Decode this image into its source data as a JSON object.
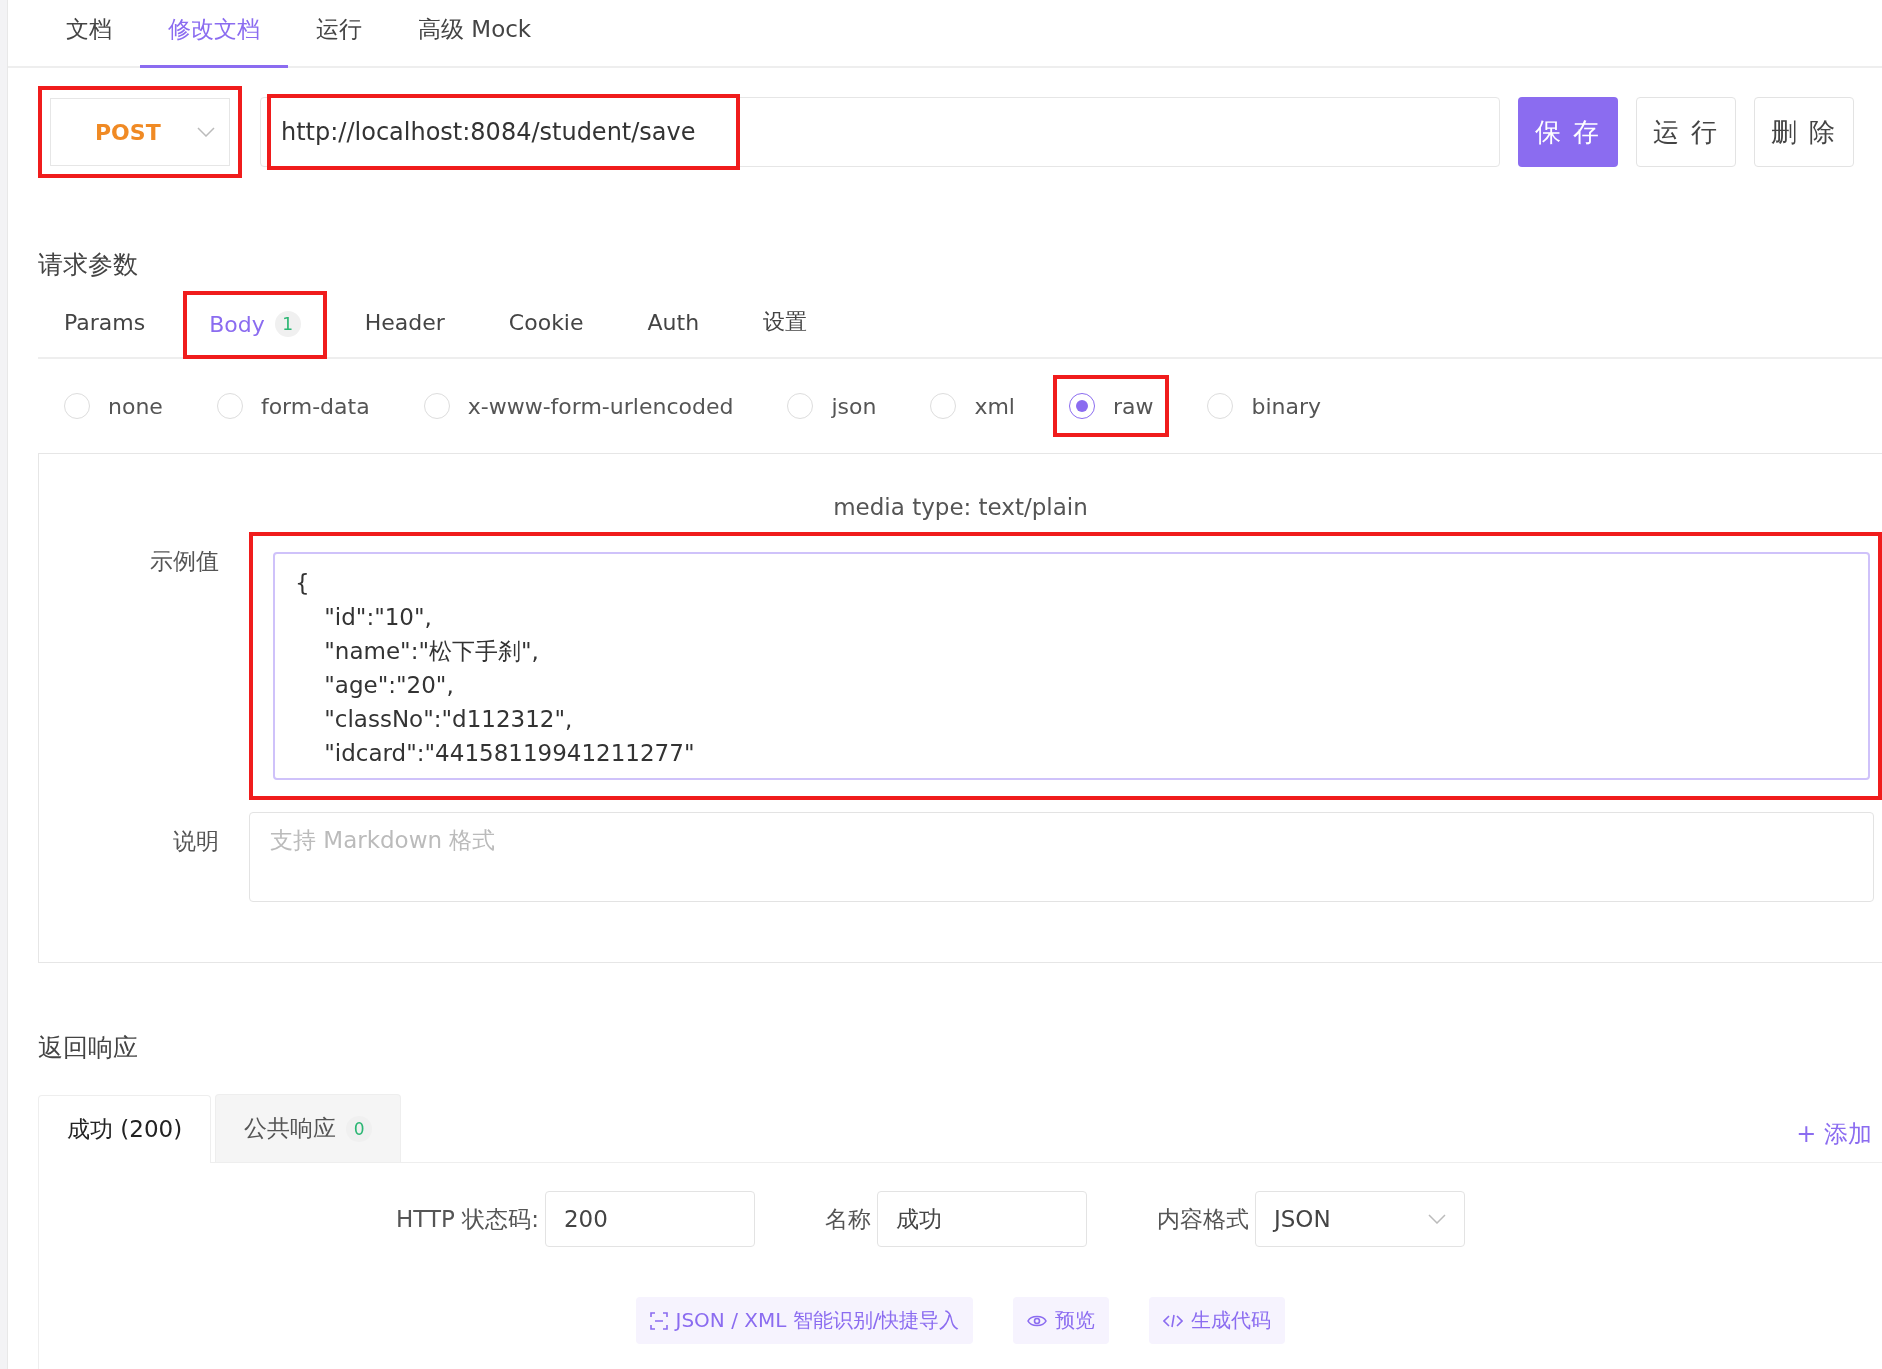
{
  "top_tabs": [
    {
      "label": "文档",
      "selected": false
    },
    {
      "label": "修改文档",
      "selected": true
    },
    {
      "label": "运行",
      "selected": false
    },
    {
      "label": "高级 Mock",
      "selected": false
    }
  ],
  "request": {
    "method": "POST",
    "method_highlighted": true,
    "url": "http://localhost:8084/student/save",
    "url_highlighted": true,
    "buttons": [
      {
        "label": "保 存",
        "kind": "primary"
      },
      {
        "label": "运 行",
        "kind": "default"
      },
      {
        "label": "删 除",
        "kind": "default"
      }
    ]
  },
  "params": {
    "title": "请求参数",
    "tabs": [
      {
        "label": "Params",
        "selected": false,
        "highlighted": false
      },
      {
        "label": "Body",
        "count": "1",
        "selected": true,
        "highlighted": true
      },
      {
        "label": "Header",
        "selected": false,
        "highlighted": false
      },
      {
        "label": "Cookie",
        "selected": false,
        "highlighted": false
      },
      {
        "label": "Auth",
        "selected": false,
        "highlighted": false
      },
      {
        "label": "设置",
        "selected": false,
        "highlighted": false
      }
    ],
    "body_types": [
      {
        "label": "none",
        "selected": false,
        "highlighted": false
      },
      {
        "label": "form-data",
        "selected": false,
        "highlighted": false
      },
      {
        "label": "x-www-form-urlencoded",
        "selected": false,
        "highlighted": false
      },
      {
        "label": "json",
        "selected": false,
        "highlighted": false
      },
      {
        "label": "xml",
        "selected": false,
        "highlighted": false
      },
      {
        "label": "raw",
        "selected": true,
        "highlighted": true
      },
      {
        "label": "binary",
        "selected": false,
        "highlighted": false
      }
    ],
    "media_type": "media type: text/plain",
    "example": {
      "label": "示例值",
      "highlighted": true,
      "lines": [
        "{",
        "    \"id\":\"10\",",
        "    \"name\":\"松下手刹\",",
        "    \"age\":\"20\",",
        "    \"classNo\":\"d112312\",",
        "    \"idcard\":\"44158119941211277\""
      ]
    },
    "description": {
      "label": "说明",
      "placeholder": "支持 Markdown 格式"
    }
  },
  "response": {
    "title": "返回响应",
    "tabs": [
      {
        "label": "成功 (200)",
        "selected": true
      },
      {
        "label": "公共响应",
        "count": "0",
        "selected": false
      }
    ],
    "add": "+ 添加",
    "fields": [
      {
        "label": "HTTP 状态码:",
        "value": "200",
        "kind": "input"
      },
      {
        "label": "名称",
        "value": "成功",
        "kind": "input"
      },
      {
        "label": "内容格式",
        "value": "JSON",
        "kind": "select"
      }
    ],
    "actions": [
      {
        "label": "JSON / XML 智能识别/快捷导入",
        "kind": "scan"
      },
      {
        "label": "预览",
        "kind": "eye"
      },
      {
        "label": "生成代码",
        "kind": "code"
      }
    ]
  }
}
